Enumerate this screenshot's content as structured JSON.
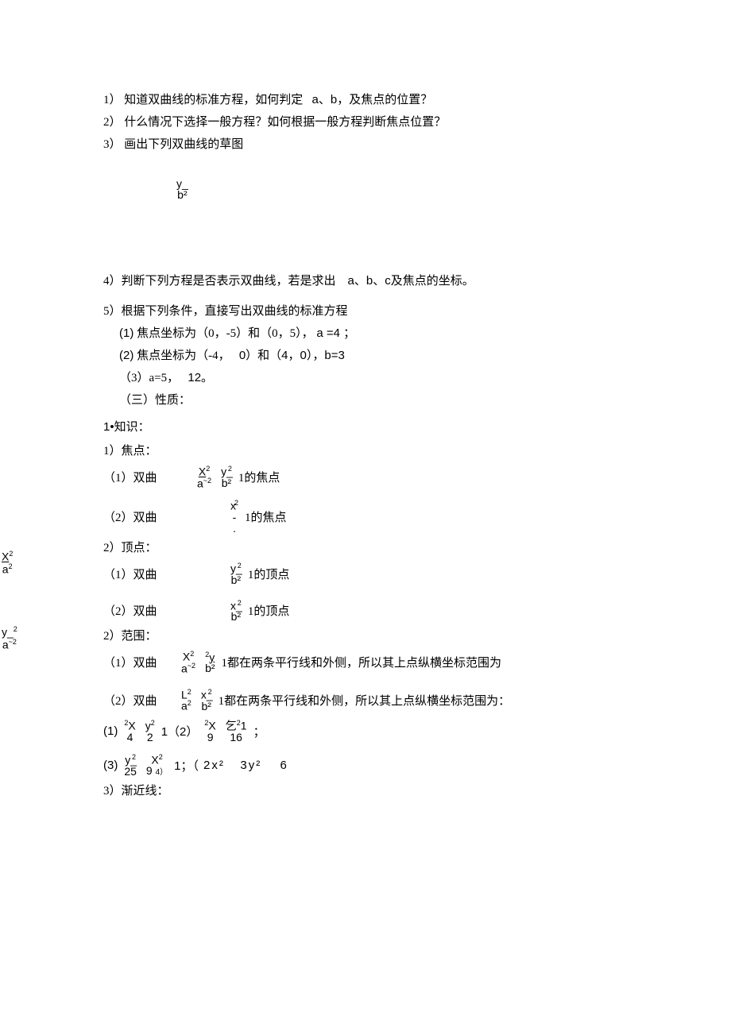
{
  "q1": "1）  知道双曲线的标准方程，如何判定",
  "q1_tail": "a、b，及焦点的位置？",
  "q2": "2）  什么情况下选择一般方程？如何根据一般方程判断焦点位置？",
  "q3": "3）  画出下列双曲线的草图",
  "frag1_top": "y_",
  "frag1_bot": "b²",
  "q4": "4）判断下列方程是否表示双曲线，若是求出",
  "q4_tail": "a、b、c及焦点的坐标。",
  "q5": "5）根据下列条件，直接写出双曲线的标准方程",
  "q5_1_pre": "(1)",
  "q5_1": "焦点坐标为（0，-5）和（0，5），",
  "q5_1_tail": "a =4 ；",
  "q5_2_pre": "(2)",
  "q5_2a": "焦点坐标为（-4，",
  "q5_2b": "0）和（4，0），b=3",
  "q5_3": "（3）a=5，",
  "q5_3_tail": "12。",
  "sec3": "（三）性质：",
  "k1": "1•知识：",
  "k1a": "1）焦点：",
  "row1_label": "（1）双曲",
  "row1_tail": "1的焦点",
  "row2_label": "（2）双曲",
  "row2_tail": "1的焦点",
  "k2a": "2）顶点：",
  "row3_label": "（1）双曲",
  "row3_tail": "1的顶点",
  "row4_label": "（2）双曲",
  "row4_tail": "1的顶点",
  "k2b": "2）范围：",
  "row5_label": "（1）双曲",
  "row5_tail": "1都在两条平行线和外侧，所以其上点纵横坐标范围为",
  "row6_label": "（2）双曲",
  "row6_tail": "1都在两条平行线和外侧，所以其上点纵横坐标范围为：",
  "eq_line1_a": "(1)",
  "eq_line1_b": "1（2）",
  "eq_line1_c": "；",
  "eq_line2_a": "(3)",
  "eq_line2_b": "1；（",
  "eq_line2_c": "2x²",
  "eq_line2_d": "3y²",
  "eq_line2_e": "6",
  "k3": "3）渐近线：",
  "frac": {
    "X2_a2": {
      "top": "X",
      "tsup": "2",
      "bot": "a",
      "bsup": "~2"
    },
    "y2_b2": {
      "top": "y_",
      "tsup": "2",
      "bot": "b²"
    },
    "x2_dot": {
      "top": "x",
      "tsup": "2",
      "under": "-",
      "bot": "."
    },
    "y2_b2b": {
      "top": "y_",
      "tsup": "2",
      "bot": "b²"
    },
    "x2_b2": {
      "top": "x_",
      "tsup": "2",
      "bot": "b²"
    },
    "X2_a": {
      "top": "X",
      "tsup": "2",
      "bot": "a",
      "bsup": "~2"
    },
    "2y_b2": {
      "top": "y",
      "tpre": "2",
      "under": "1",
      "bot": "b²"
    },
    "L2_a": {
      "top": "L",
      "tsup": "2",
      "bot": "a",
      "bsup": "2"
    },
    "x2_b2b": {
      "top": "x_",
      "tsup": "2",
      "bot": "b²"
    },
    "2X_4": {
      "top": "X",
      "tpre": "2",
      "bot": "4"
    },
    "y2_2": {
      "top": "y",
      "tsup": "2",
      "bot": "2"
    },
    "2X_9": {
      "top": "X",
      "tpre": "2",
      "bot": "9"
    },
    "yi2_16": {
      "top": "乞",
      "tsup": "2",
      "bot": "16",
      "after": "1"
    },
    "y2_25": {
      "top": "y_",
      "tsup": "2",
      "bot": "25"
    },
    "X2_9": {
      "top": "X",
      "tsup": "2",
      "bot": "9",
      "bsuf": "4）"
    }
  },
  "floats": {
    "f1": {
      "top": "X",
      "tsup": "2",
      "ul": true,
      "bot": "a",
      "bsup": "2"
    },
    "f2": {
      "top": "y_",
      "tsup": "2",
      "bot": "a",
      "bsup": "~2"
    }
  }
}
